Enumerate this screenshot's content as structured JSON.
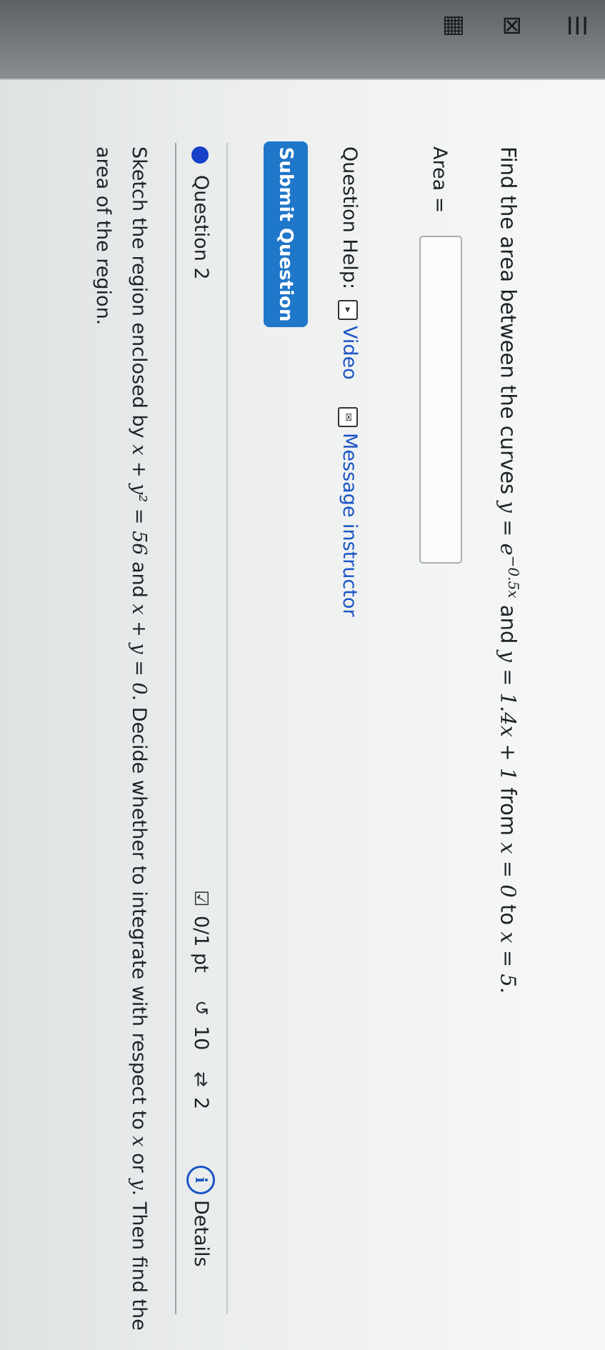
{
  "question1": {
    "prompt_text": "Find the area between the curves",
    "eq1_lhs": "y = e",
    "eq1_exp": "−0.5x",
    "and": "and",
    "eq2": "y = 1.4x + 1",
    "from": "from",
    "eq3": "x = 0",
    "to": "to",
    "eq4": "x = 5.",
    "area_label": "Area =",
    "area_value": "",
    "help_label": "Question Help:",
    "video_label": "Video",
    "message_label": "Message instructor",
    "submit_label": "Submit Question"
  },
  "question2": {
    "title": "Question 2",
    "score": "0/1 pt",
    "attempts": "10",
    "retries": "2",
    "details_label": "Details",
    "info_glyph": "i",
    "body_part1": "Sketch the region enclosed by",
    "eq_a": "x + y² = 56",
    "body_and": "and",
    "eq_b": "x + y = 0",
    "body_part2": ". Decide whether to integrate with respect to",
    "var_x": "x",
    "body_or": "or",
    "var_y": "y",
    "body_part3": ". Then find the area of the region."
  },
  "icons": {
    "video": "play-icon",
    "message": "mail-icon",
    "score": "check-icon",
    "attempts": "undo-icon",
    "retries": "repeat-icon",
    "details": "info-icon"
  },
  "colors": {
    "accent": "#1f77c9",
    "link": "#1a55c4",
    "question_dot": "#1742c8"
  }
}
